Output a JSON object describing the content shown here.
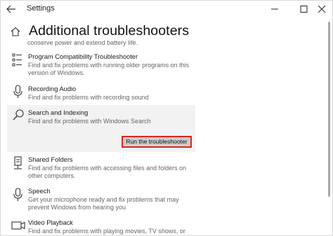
{
  "window": {
    "title": "Settings"
  },
  "header": {
    "title": "Additional troubleshooters"
  },
  "partial_item_description": "conserve power and extend battery life.",
  "items": [
    {
      "title": "Program Compatibility Troubleshooter",
      "description": "Find and fix problems with running older programs on this version of Windows.",
      "icon": "list-icon"
    },
    {
      "title": "Recording Audio",
      "description": "Find and fix problems with recording sound",
      "icon": "microphone-icon"
    },
    {
      "title": "Search and Indexing",
      "description": "Find and fix problems with Windows Search",
      "icon": "search-icon",
      "selected": true,
      "button": "Run the troubleshooter"
    },
    {
      "title": "Shared Folders",
      "description": "Find and fix problems with accessing files and folders on other computers.",
      "icon": "server-icon"
    },
    {
      "title": "Speech",
      "description": "Get your microphone ready and fix problems that may prevent Windows from hearing you",
      "icon": "microphone-icon"
    },
    {
      "title": "Video Playback",
      "description": "Find and fix problems with playing movies, TV shows, or video",
      "icon": "video-icon"
    }
  ],
  "colors": {
    "highlight_border": "#d9281f",
    "selected_background": "#f2f2f2",
    "button_background": "#cccccc"
  }
}
